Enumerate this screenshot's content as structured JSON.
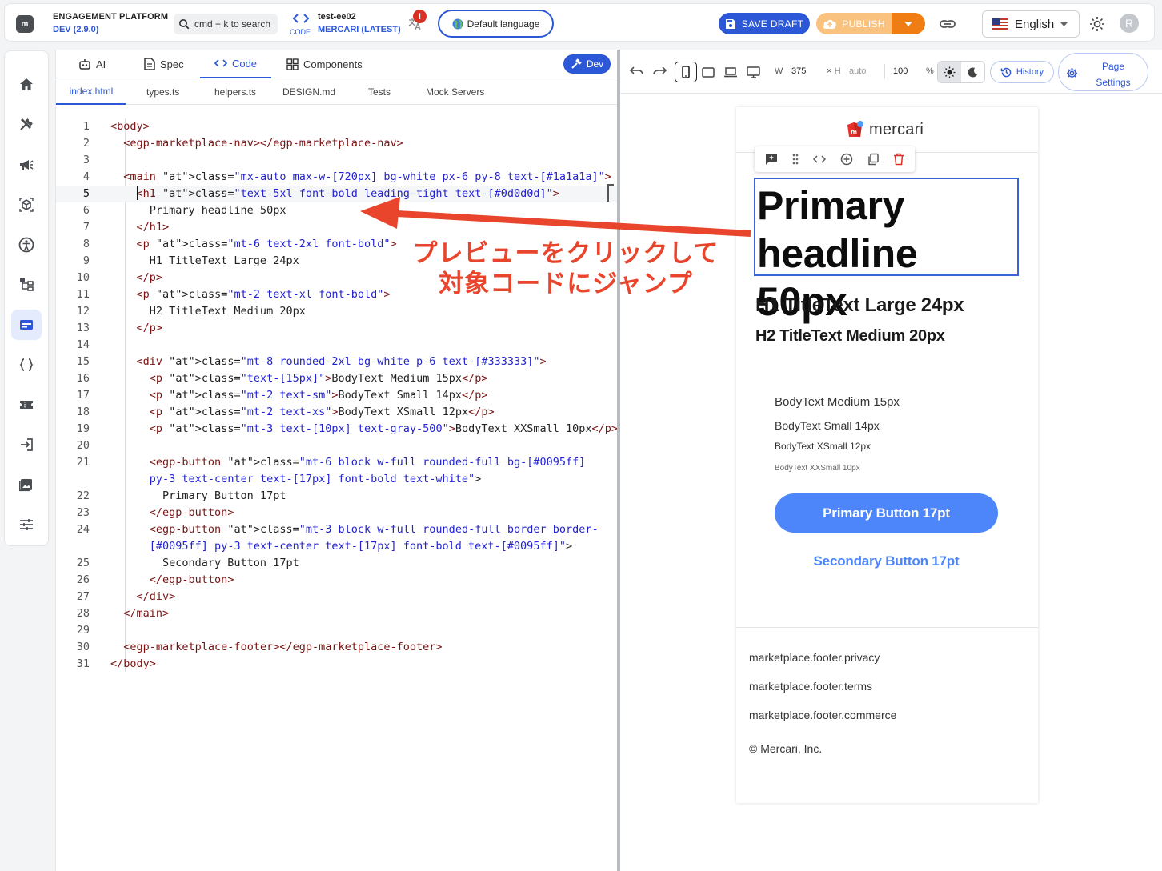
{
  "app": {
    "logo_text": "m",
    "title": "ENGAGEMENT PLATFORM",
    "version": "DEV (2.9.0)",
    "search_placeholder": "cmd + k to search",
    "code_label": "CODE",
    "env_name": "test-ee02",
    "env_branch": "MERCARI (LATEST)",
    "warning_badge": "!",
    "language_button": "Default language",
    "save_draft": "SAVE DRAFT",
    "publish": "PUBLISH",
    "language_select": "English",
    "avatar_initial": "R",
    "colors": {
      "primary": "#2c57d6",
      "publish": "#f9c27e",
      "publish_dropdown": "#ef7d14",
      "annotation": "#e8452c"
    }
  },
  "sidebar": {
    "items": [
      {
        "icon": "home-icon",
        "active": false
      },
      {
        "icon": "tools-icon",
        "active": false
      },
      {
        "icon": "megaphone-icon",
        "active": false
      },
      {
        "icon": "cube-icon",
        "active": false
      },
      {
        "icon": "accessibility-icon",
        "active": false
      },
      {
        "icon": "tree-icon",
        "active": false
      },
      {
        "icon": "web-layout-icon",
        "active": true
      },
      {
        "icon": "braces-icon",
        "active": false
      },
      {
        "icon": "ticket-icon",
        "active": false
      },
      {
        "icon": "login-icon",
        "active": false
      },
      {
        "icon": "image-icon",
        "active": false
      },
      {
        "icon": "sliders-icon",
        "active": false
      }
    ]
  },
  "editor": {
    "tabs": [
      {
        "label": "AI",
        "icon": "robot-icon"
      },
      {
        "label": "Spec",
        "icon": "document-icon"
      },
      {
        "label": "Code",
        "icon": "code-icon",
        "active": true
      },
      {
        "label": "Components",
        "icon": "components-icon"
      }
    ],
    "dev_button": "Dev",
    "files": [
      "index.html",
      "types.ts",
      "helpers.ts",
      "DESIGN.md",
      "Tests",
      "Mock Servers"
    ],
    "active_file": "index.html",
    "current_line": 5,
    "lines": [
      {
        "n": "1",
        "text": "<body>"
      },
      {
        "n": "2",
        "text": "  <egp-marketplace-nav></egp-marketplace-nav>"
      },
      {
        "n": "3",
        "text": ""
      },
      {
        "n": "4",
        "text": "  <main class=\"mx-auto max-w-[720px] bg-white px-6 py-8 text-[#1a1a1a]\">"
      },
      {
        "n": "5",
        "text": "    <h1 class=\"text-5xl font-bold leading-tight text-[#0d0d0d]\">"
      },
      {
        "n": "6",
        "text": "      Primary headline 50px"
      },
      {
        "n": "7",
        "text": "    </h1>"
      },
      {
        "n": "8",
        "text": "    <p class=\"mt-6 text-2xl font-bold\">"
      },
      {
        "n": "9",
        "text": "      H1 TitleText Large 24px"
      },
      {
        "n": "10",
        "text": "    </p>"
      },
      {
        "n": "11",
        "text": "    <p class=\"mt-2 text-xl font-bold\">"
      },
      {
        "n": "12",
        "text": "      H2 TitleText Medium 20px"
      },
      {
        "n": "13",
        "text": "    </p>"
      },
      {
        "n": "14",
        "text": ""
      },
      {
        "n": "15",
        "text": "    <div class=\"mt-8 rounded-2xl bg-white p-6 text-[#333333]\">"
      },
      {
        "n": "16",
        "text": "      <p class=\"text-[15px]\">BodyText Medium 15px</p>"
      },
      {
        "n": "17",
        "text": "      <p class=\"mt-2 text-sm\">BodyText Small 14px</p>"
      },
      {
        "n": "18",
        "text": "      <p class=\"mt-2 text-xs\">BodyText XSmall 12px</p>"
      },
      {
        "n": "19",
        "text": "      <p class=\"mt-3 text-[10px] text-gray-500\">BodyText XXSmall 10px</p>"
      },
      {
        "n": "20",
        "text": ""
      },
      {
        "n": "21",
        "text": "      <egp-button class=\"mt-6 block w-full rounded-full bg-[#0095ff]"
      },
      {
        "n": "",
        "text": "      py-3 text-center text-[17px] font-bold text-white\">"
      },
      {
        "n": "22",
        "text": "        Primary Button 17pt"
      },
      {
        "n": "23",
        "text": "      </egp-button>"
      },
      {
        "n": "24",
        "text": "      <egp-button class=\"mt-3 block w-full rounded-full border border-"
      },
      {
        "n": "",
        "text": "      [#0095ff] py-3 text-center text-[17px] font-bold text-[#0095ff]\">"
      },
      {
        "n": "25",
        "text": "        Secondary Button 17pt"
      },
      {
        "n": "26",
        "text": "      </egp-button>"
      },
      {
        "n": "27",
        "text": "    </div>"
      },
      {
        "n": "28",
        "text": "  </main>"
      },
      {
        "n": "29",
        "text": ""
      },
      {
        "n": "30",
        "text": "  <egp-marketplace-footer></egp-marketplace-footer>"
      },
      {
        "n": "31",
        "text": "</body>"
      }
    ]
  },
  "preview": {
    "toolbar": {
      "width_label": "W",
      "width_value": "375",
      "height_label": "× H",
      "height_value": "auto",
      "zoom_value": "100",
      "zoom_unit": "%",
      "history": "History",
      "page_settings": "Page\nSettings"
    },
    "page": {
      "brand": "mercari",
      "h1": "Primary headline 50px",
      "title_large": "H1 TitleText Large 24px",
      "title_medium": "H2 TitleText Medium 20px",
      "body_medium": "BodyText Medium 15px",
      "body_small": "BodyText Small 14px",
      "body_xsmall": "BodyText XSmall 12px",
      "body_xxsmall": "BodyText XXSmall 10px",
      "primary_button": "Primary Button 17pt",
      "secondary_button": "Secondary Button 17pt",
      "footer": [
        "marketplace.footer.privacy",
        "marketplace.footer.terms",
        "marketplace.footer.commerce"
      ],
      "copyright": "© Mercari, Inc."
    }
  },
  "annotation": {
    "text": "プレビューをクリックして\n対象コードにジャンプ"
  }
}
